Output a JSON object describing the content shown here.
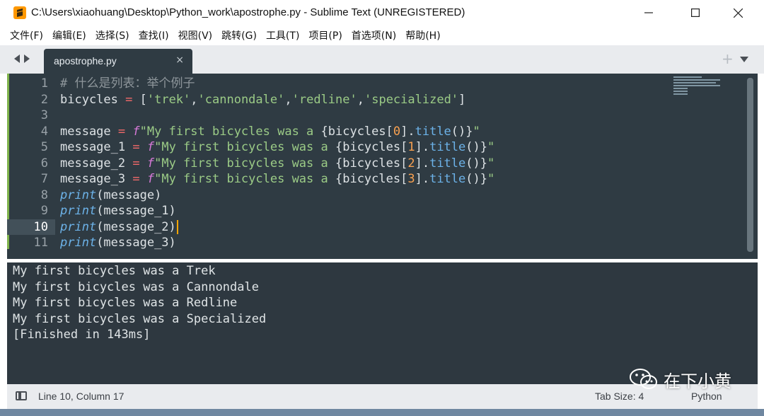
{
  "window": {
    "title": "C:\\Users\\xiaohuang\\Desktop\\Python_work\\apostrophe.py - Sublime Text (UNREGISTERED)",
    "controls": {
      "minimize": "minimize",
      "maximize": "maximize",
      "close": "close"
    }
  },
  "menu": [
    "文件(F)",
    "编辑(E)",
    "选择(S)",
    "查找(I)",
    "视图(V)",
    "跳转(G)",
    "工具(T)",
    "项目(P)",
    "首选项(N)",
    "帮助(H)"
  ],
  "tab": {
    "label": "apostrophe.py",
    "close": "×",
    "new_tab": "+"
  },
  "editor": {
    "active_line": 10,
    "lines": [
      {
        "n": "1",
        "text": "# 什么是列表：举个例子"
      },
      {
        "n": "2",
        "text": "bicycles = ['trek','cannondale','redline','specialized']"
      },
      {
        "n": "3",
        "text": ""
      },
      {
        "n": "4",
        "text": "message = f\"My first bicycles was a {bicycles[0].title()}\""
      },
      {
        "n": "5",
        "text": "message_1 = f\"My first bicycles was a {bicycles[1].title()}\""
      },
      {
        "n": "6",
        "text": "message_2 = f\"My first bicycles was a {bicycles[2].title()}\""
      },
      {
        "n": "7",
        "text": "message_3 = f\"My first bicycles was a {bicycles[3].title()}\""
      },
      {
        "n": "8",
        "text": "print(message)"
      },
      {
        "n": "9",
        "text": "print(message_1)"
      },
      {
        "n": "10",
        "text": "print(message_2)"
      },
      {
        "n": "11",
        "text": "print(message_3)"
      }
    ]
  },
  "output": {
    "lines": [
      "My first bicycles was a Trek",
      "My first bicycles was a Cannondale",
      "My first bicycles was a Redline",
      "My first bicycles was a Specialized",
      "[Finished in 143ms]"
    ]
  },
  "status": {
    "position": "Line 10, Column 17",
    "tab_size": "Tab Size: 4",
    "syntax": "Python"
  },
  "watermark": {
    "text": "在下小黄"
  },
  "colors": {
    "accent_icon": "#ff9800",
    "editor_bg": "#2f3b43",
    "output_bg": "#2e3840",
    "gutter_mark": "#7fb24b"
  }
}
